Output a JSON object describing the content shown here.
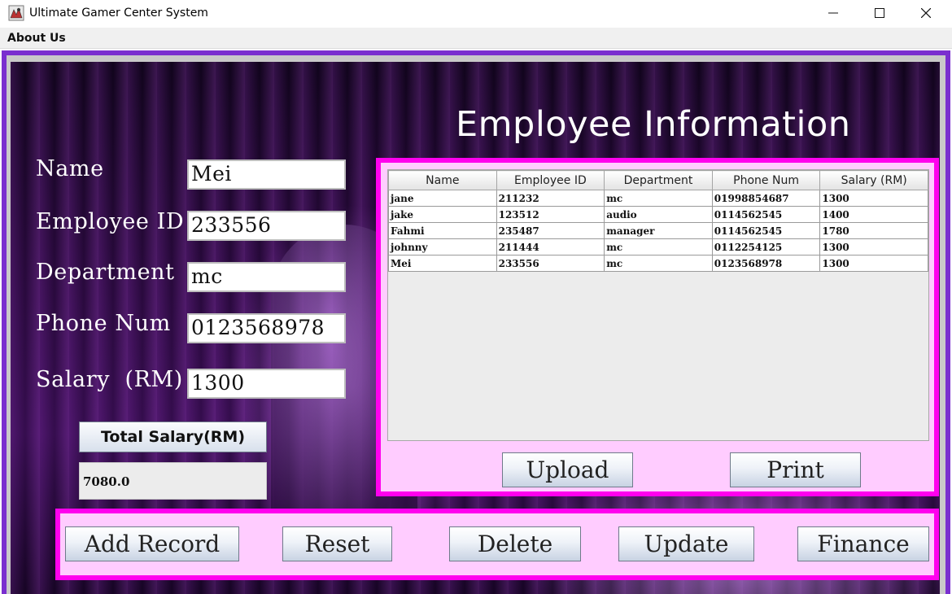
{
  "window": {
    "title": "Ultimate Gamer Center System",
    "menu": [
      "About Us"
    ],
    "controls": [
      "minimize-icon",
      "maximize-icon",
      "close-icon"
    ]
  },
  "heading": "Employee Information",
  "form": {
    "name": {
      "label": "Name",
      "value": "Mei"
    },
    "employee_id": {
      "label": "Employee ID",
      "value": "233556"
    },
    "department": {
      "label": "Department",
      "value": "mc"
    },
    "phone": {
      "label": "Phone Num",
      "value": "0123568978"
    },
    "salary": {
      "label": "Salary  (RM)",
      "value": "1300"
    }
  },
  "total": {
    "button_label": "Total Salary(RM)",
    "value": "7080.0"
  },
  "table": {
    "columns": [
      "Name",
      "Employee ID",
      "Department",
      "Phone Num",
      "Salary (RM)"
    ],
    "rows": [
      [
        "jane",
        "211232",
        "mc",
        "01998854687",
        "1300"
      ],
      [
        "jake",
        "123512",
        "audio",
        "0114562545",
        "1400"
      ],
      [
        "Fahmi",
        "235487",
        "manager",
        "0114562545",
        "1780"
      ],
      [
        "johnny",
        "211444",
        "mc",
        "0112254125",
        "1300"
      ],
      [
        "Mei",
        "233556",
        "mc",
        "0123568978",
        "1300"
      ]
    ]
  },
  "panel_buttons": {
    "upload": "Upload",
    "print": "Print"
  },
  "actions": {
    "add": "Add Record",
    "reset": "Reset",
    "delete": "Delete",
    "update": "Update",
    "finance": "Finance"
  },
  "colors": {
    "frame": "#7a2fcf",
    "panel_border": "#ff00ee",
    "panel_fill": "#ffccff"
  }
}
